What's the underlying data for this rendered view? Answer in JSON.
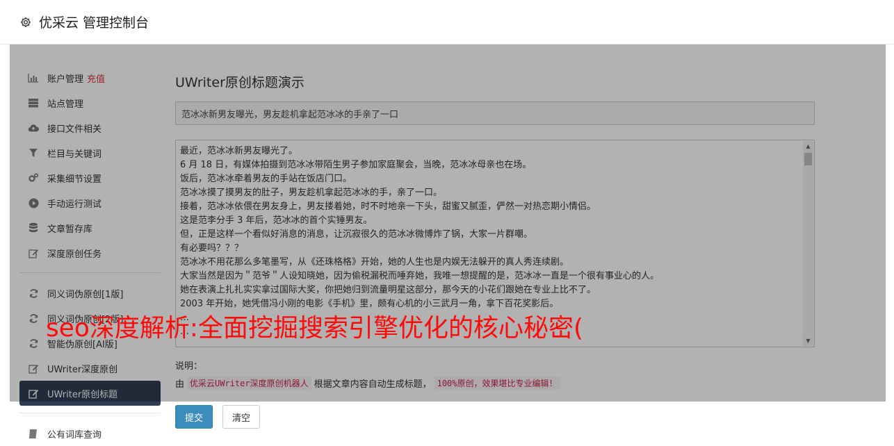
{
  "app": {
    "title": "优采云 管理控制台",
    "icon": "gear-icon"
  },
  "sidebar": {
    "items": [
      {
        "label": "账户管理",
        "extra": "充值",
        "icon": "bar-chart-icon"
      },
      {
        "label": "站点管理",
        "icon": "server-icon"
      },
      {
        "label": "接口文件相关",
        "icon": "cloud-upload-icon"
      },
      {
        "label": "栏目与关键词",
        "icon": "filter-icon"
      },
      {
        "label": "采集细节设置",
        "icon": "gears-icon"
      },
      {
        "label": "手动运行测试",
        "icon": "play-circle-icon"
      },
      {
        "label": "文章暂存库",
        "icon": "database-icon"
      },
      {
        "label": "深度原创任务",
        "icon": "edit-icon"
      }
    ],
    "items2": [
      {
        "label": "同义词伪原创[1版]",
        "icon": "refresh-icon"
      },
      {
        "label": "同义词伪原创[2版]",
        "icon": "refresh-icon"
      },
      {
        "label": "智能伪原创[AI版]",
        "icon": "refresh-icon"
      },
      {
        "label": "UWriter深度原创",
        "icon": "edit-icon"
      },
      {
        "label": "UWriter原创标题",
        "icon": "edit-icon",
        "active": true
      }
    ],
    "items3": [
      {
        "label": "公有词库查询",
        "icon": "book-icon"
      }
    ]
  },
  "main": {
    "heading": "UWriter原创标题演示",
    "title_value": "范冰冰新男友曝光，男友趁机拿起范冰冰的手亲了一口",
    "content_lines": [
      "最近，范冰冰新男友曝光了。",
      "6 月 18 日，有媒体拍摄到范冰冰带陌生男子参加家庭聚会，当晚，范冰冰母亲也在场。",
      "饭后，范冰冰牵着男友的手站在饭店门口。",
      "范冰冰摸了摸男友的肚子，男友趁机拿起范冰冰的手，亲了一口。",
      "接着，范冰冰依偎在男友身上，男友搂着她，时不时地亲一下头，甜蜜又腻歪，俨然一对热恋期小情侣。",
      "这是范李分手 3 年后，范冰冰的首个实锤男友。",
      "但，正是这样一个看似好消息的消息，让沉寂很久的范冰冰微博炸了锅，大家一片群嘲。",
      "有必要吗？？？",
      "范冰冰不用花那么多笔墨写，从《还珠格格》开始，她的人生也是内娱无法躲开的真人秀连续剧。",
      "大家当然是因为＂范爷＂人设知晓她，因为偷税漏税而唾弃她，我唯一想提醒的是，范冰冰一直是一个很有事业心的人。",
      "她在表演上扎扎实实拿过国际大奖，你把她归到流量明星这部分，那今天的小花们跟她在专业上比不了。",
      "2003 年开始，她凭借冯小刚的电影《手机》里，颇有心机的小三武月一角，拿下百花奖影后。",
      "…",
      "…"
    ],
    "note_label": "说明：",
    "note_prefix": "由",
    "note_code1": "优采云UWriter深度原创机器人",
    "note_middle": "根据文章内容自动生成标题，",
    "note_code2": "100%原创，效果堪比专业编辑！",
    "submit_label": "提交",
    "clear_label": "清空"
  },
  "watermark": "seo深度解析:全面挖掘搜索引擎优化的核心秘密(",
  "colors": {
    "active_bg": "#2f3d52",
    "primary": "#3c8dbc",
    "accent_red": "#d9343b",
    "watermark": "#ff0a0a"
  }
}
